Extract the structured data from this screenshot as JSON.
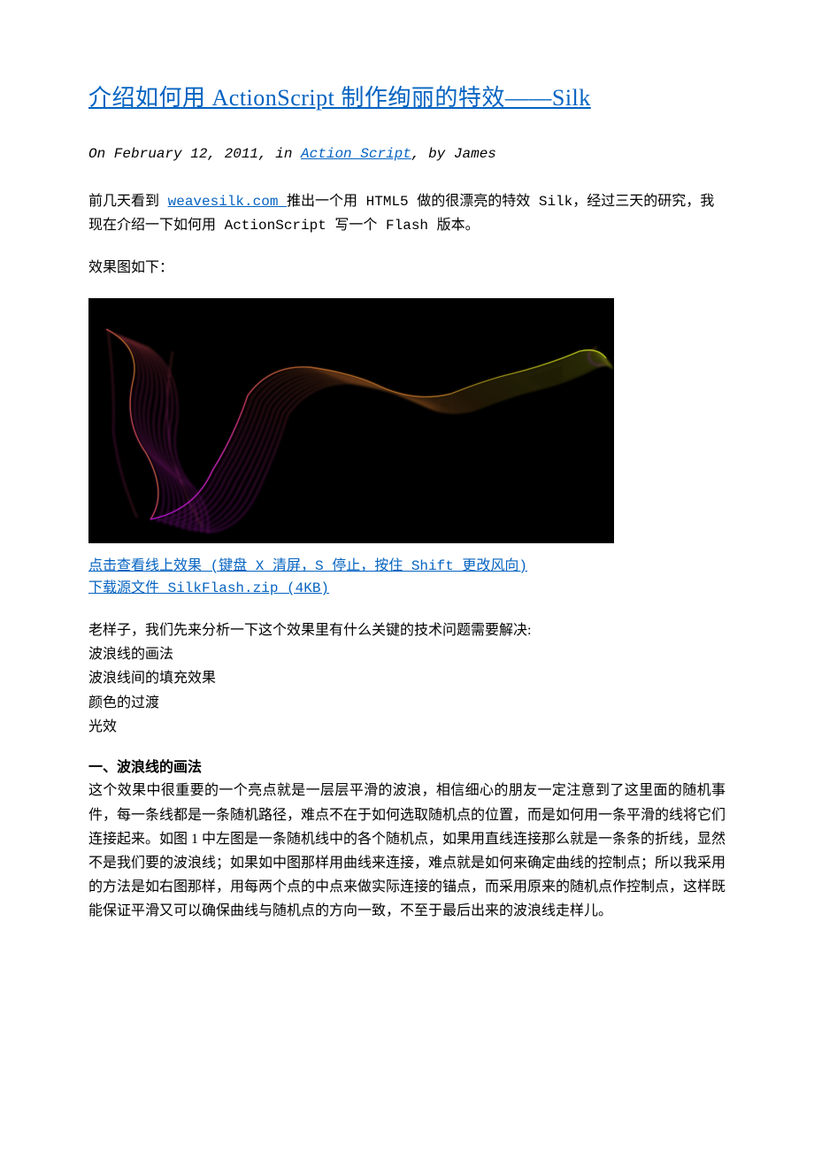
{
  "title": "介绍如何用 ActionScript 制作绚丽的特效——Silk",
  "meta": {
    "prefix": "On February 12, 2011, in ",
    "category": "Action Script",
    "suffix": ", by James"
  },
  "intro": {
    "pre": "前几天看到 ",
    "site": "weavesilk.com ",
    "post": "推出一个用 HTML5 做的很漂亮的特效 Silk，经过三天的研究，我现在介绍一下如何用 ActionScript 写一个 Flash 版本。"
  },
  "effect_label": "效果图如下：",
  "figure_alt": "silk-effect-rendering",
  "links": {
    "online": "点击查看线上效果 (键盘 X 清屏，S 停止，按住 Shift 更改风向)",
    "download": "下载源文件 SilkFlash.zip (4KB)"
  },
  "analysis_intro": "老样子，我们先来分析一下这个效果里有什么关键的技术问题需要解决:",
  "problems": [
    "波浪线的画法",
    "波浪线间的填充效果",
    "颜色的过渡",
    "光效"
  ],
  "section1": {
    "head": "一、波浪线的画法",
    "body": "这个效果中很重要的一个亮点就是一层层平滑的波浪，相信细心的朋友一定注意到了这里面的随机事件，每一条线都是一条随机路径，难点不在于如何选取随机点的位置，而是如何用一条平滑的线将它们连接起来。如图 1 中左图是一条随机线中的各个随机点，如果用直线连接那么就是一条条的折线，显然不是我们要的波浪线；如果如中图那样用曲线来连接，难点就是如何来确定曲线的控制点；所以我采用的方法是如右图那样，用每两个点的中点来做实际连接的锚点，而采用原来的随机点作控制点，这样既能保证平滑又可以确保曲线与随机点的方向一致，不至于最后出来的波浪线走样儿。"
  }
}
